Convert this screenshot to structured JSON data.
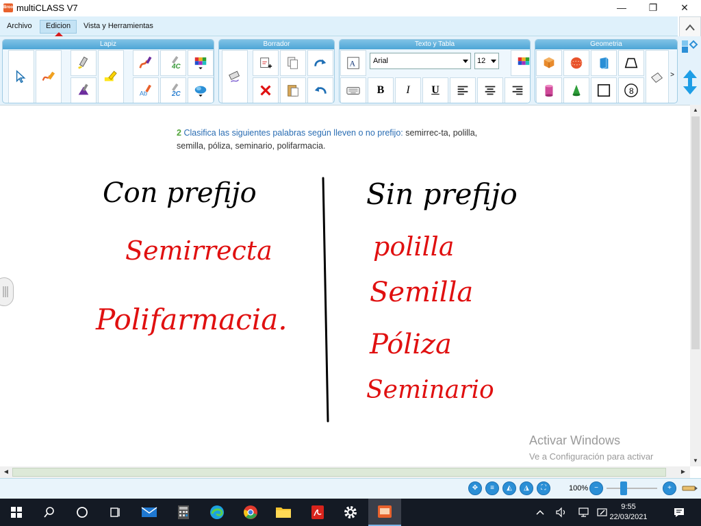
{
  "window": {
    "title": "multiCLASS V7",
    "app_icon_text": "Brook",
    "minimize": "—",
    "maximize": "❐",
    "close": "✕"
  },
  "menu": {
    "items": [
      "Archivo",
      "Edicion",
      "Vista y Herramientas"
    ]
  },
  "ribbon": {
    "groups": [
      "Lapiz",
      "Borrador",
      "Texto y Tabla",
      "Geometria"
    ],
    "font": "Arial",
    "font_size": "12",
    "pen_labels": [
      "4C",
      "2C"
    ],
    "octagon_label": "8",
    "more_label": ">"
  },
  "exercise": {
    "number": "2",
    "instruction": "Clasifica las siguientes palabras según lleven o no prefijo:",
    "words": "semirrec-ta, polilla, semilla, póliza, seminario, polifarmacia."
  },
  "handwriting": {
    "left_header": "Con prefijo",
    "right_header": "Sin prefijo",
    "left_words": [
      "Semirrecta",
      "Polifarmacia."
    ],
    "right_words": [
      "polilla",
      "Semilla",
      "Póliza",
      "Seminario"
    ],
    "ink_color": "#e01010",
    "header_color": "#000000"
  },
  "watermark": {
    "title": "Activar Windows",
    "subtitle": "Ve a Configuración para activar Windows."
  },
  "statusbar": {
    "zoom": "100%"
  },
  "taskbar": {
    "time": "9:55",
    "date": "22/03/2021",
    "accent": "#141a24"
  }
}
